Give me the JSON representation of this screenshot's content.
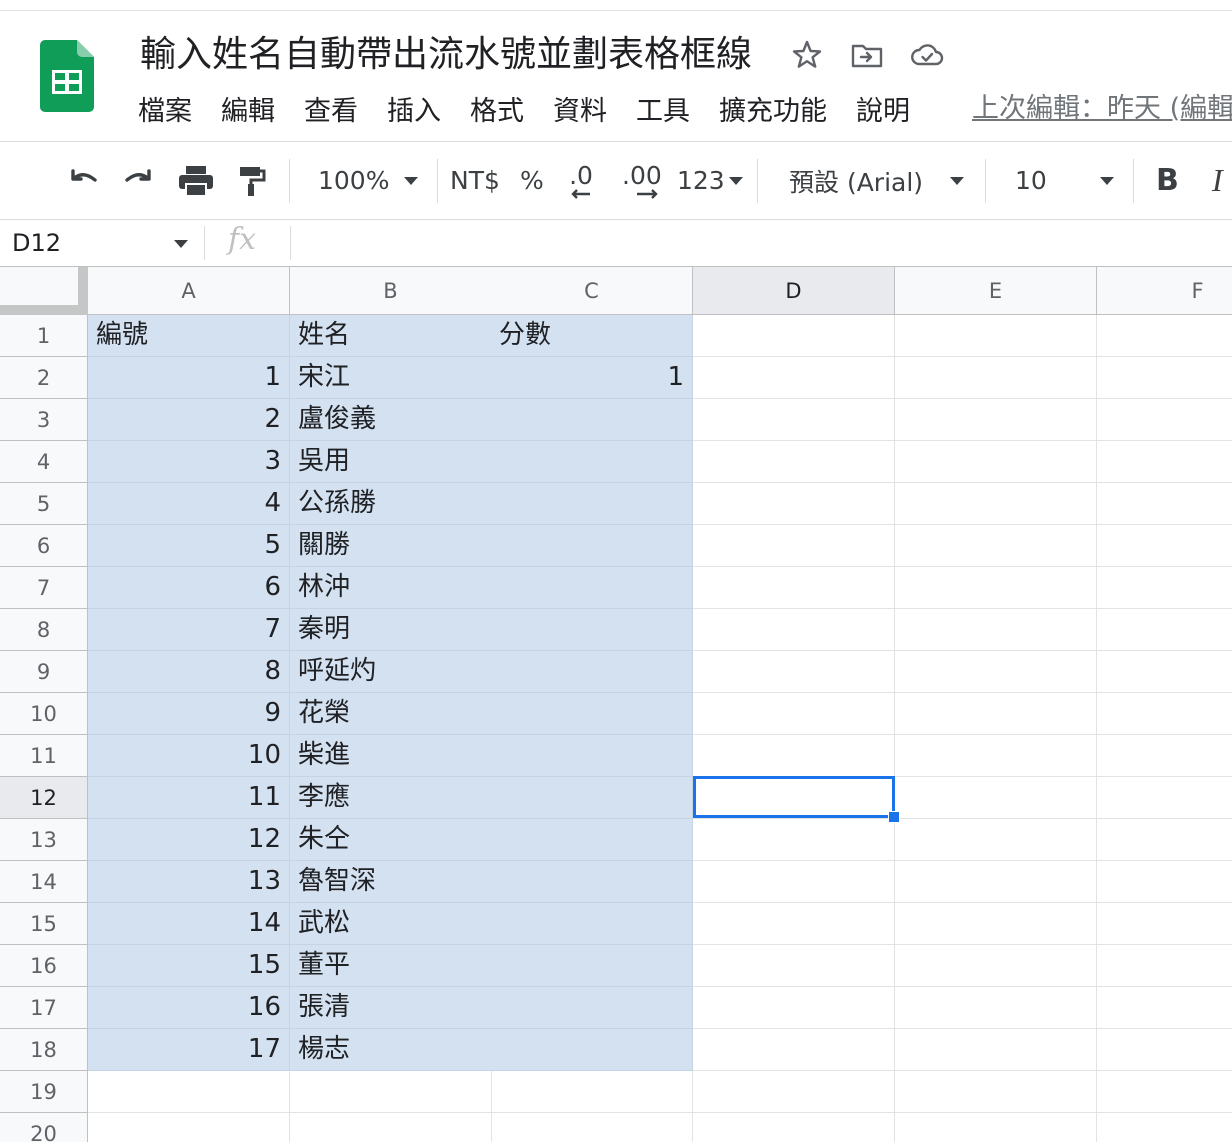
{
  "document": {
    "title": "輸入姓名自動帶出流水號並劃表格框線"
  },
  "menu": [
    "檔案",
    "編輯",
    "查看",
    "插入",
    "格式",
    "資料",
    "工具",
    "擴充功能",
    "說明"
  ],
  "last_edit": "上次編輯：昨天 (編輯",
  "toolbar": {
    "zoom": "100%",
    "currency": "NT$",
    "percent": "%",
    "decrease_decimal": ".0",
    "increase_decimal": ".00",
    "more_formats": "123",
    "font": "預設 (Arial)",
    "font_size": "10",
    "bold": "B",
    "italic": "I"
  },
  "formula_bar": {
    "name_box": "D12",
    "fx": "fx",
    "value": ""
  },
  "sheet": {
    "columns": [
      "A",
      "B",
      "C",
      "D",
      "E",
      "F"
    ],
    "active_column": "D",
    "active_row": "12",
    "rows": [
      {
        "num": "1",
        "a": "編號",
        "b": "姓名",
        "c": "分數"
      },
      {
        "num": "2",
        "a": "1",
        "b": "宋江",
        "c": "1"
      },
      {
        "num": "3",
        "a": "2",
        "b": "盧俊義",
        "c": ""
      },
      {
        "num": "4",
        "a": "3",
        "b": "吳用",
        "c": ""
      },
      {
        "num": "5",
        "a": "4",
        "b": "公孫勝",
        "c": ""
      },
      {
        "num": "6",
        "a": "5",
        "b": "關勝",
        "c": ""
      },
      {
        "num": "7",
        "a": "6",
        "b": "林沖",
        "c": ""
      },
      {
        "num": "8",
        "a": "7",
        "b": "秦明",
        "c": ""
      },
      {
        "num": "9",
        "a": "8",
        "b": "呼延灼",
        "c": ""
      },
      {
        "num": "10",
        "a": "9",
        "b": "花榮",
        "c": ""
      },
      {
        "num": "11",
        "a": "10",
        "b": "柴進",
        "c": ""
      },
      {
        "num": "12",
        "a": "11",
        "b": "李應",
        "c": ""
      },
      {
        "num": "13",
        "a": "12",
        "b": "朱仝",
        "c": ""
      },
      {
        "num": "14",
        "a": "13",
        "b": "魯智深",
        "c": ""
      },
      {
        "num": "15",
        "a": "14",
        "b": "武松",
        "c": ""
      },
      {
        "num": "16",
        "a": "15",
        "b": "董平",
        "c": ""
      },
      {
        "num": "17",
        "a": "16",
        "b": "張清",
        "c": ""
      },
      {
        "num": "18",
        "a": "17",
        "b": "楊志",
        "c": ""
      },
      {
        "num": "19",
        "a": "",
        "b": "",
        "c": ""
      },
      {
        "num": "20",
        "a": "",
        "b": "",
        "c": ""
      }
    ]
  },
  "colors": {
    "sheets_green": "#0f9d58",
    "selection_fill": "#d3e1f1",
    "active_border": "#1a73e8"
  }
}
